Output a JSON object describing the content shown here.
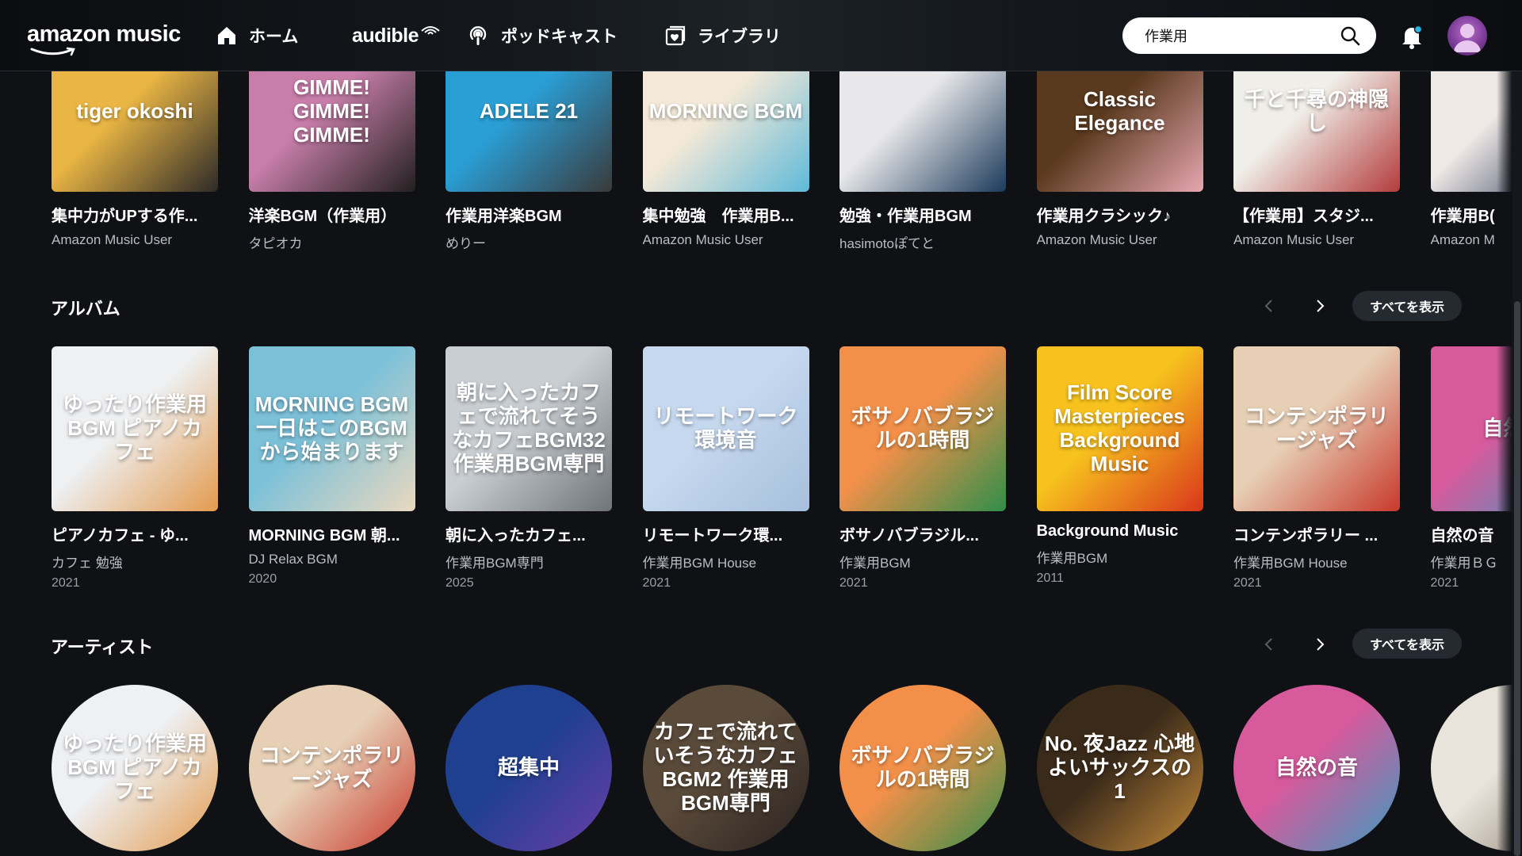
{
  "header": {
    "logo": "amazon music",
    "nav": [
      {
        "label": "ホーム",
        "icon": "home-icon"
      },
      {
        "label": "audible",
        "icon": "audible-icon"
      },
      {
        "label": "ポッドキャスト",
        "icon": "podcast-icon"
      },
      {
        "label": "ライブラリ",
        "icon": "library-icon"
      }
    ],
    "search": {
      "value": "作業用",
      "placeholder": ""
    }
  },
  "playlists": [
    {
      "title": "集中力がUPする作...",
      "sub": "Amazon Music User",
      "colors": [
        "#e9b544",
        "#2d2a28"
      ],
      "art_text": "tiger okoshi"
    },
    {
      "title": "洋楽BGM（作業用）",
      "sub": "タピオカ",
      "colors": [
        "#c77ea9",
        "#232020"
      ],
      "art_text": "GIMME! GIMME! GIMME!"
    },
    {
      "title": "作業用洋楽BGM",
      "sub": "めりー",
      "colors": [
        "#2a9fd6",
        "#3a3a3a"
      ],
      "art_text": "ADELE 21"
    },
    {
      "title": "集中勉強　作業用B...",
      "sub": "Amazon Music User",
      "colors": [
        "#f4e9d8",
        "#5fb9d8"
      ],
      "art_text": "MORNING BGM"
    },
    {
      "title": "勉強・作業用BGM",
      "sub": "hasimotoぽてと",
      "colors": [
        "#e8e8ea",
        "#1b3a5a"
      ],
      "art_text": ""
    },
    {
      "title": "作業用クラシック♪",
      "sub": "Amazon Music User",
      "colors": [
        "#5a3a1e",
        "#e6a6b0"
      ],
      "art_text": "Classic Elegance"
    },
    {
      "title": "【作業用】スタジ...",
      "sub": "Amazon Music User",
      "colors": [
        "#f0eee8",
        "#b33c3c"
      ],
      "art_text": "千と千尋の神隠し"
    },
    {
      "title": "作業用B(",
      "sub": "Amazon M",
      "colors": [
        "#efe9e6",
        "#1a2a4a"
      ],
      "art_text": ""
    }
  ],
  "albums_section": {
    "title": "アルバム",
    "show_all": "すべてを表示"
  },
  "albums": [
    {
      "title": "ピアノカフェ - ゆ...",
      "artist": "カフェ 勉強",
      "year": "2021",
      "colors": [
        "#eef0f2",
        "#e39a4e"
      ],
      "art_text": "ゆったり作業用BGM ピアノカフェ"
    },
    {
      "title": "MORNING BGM 朝...",
      "artist": "DJ Relax BGM",
      "year": "2020",
      "colors": [
        "#7cc0d8",
        "#e9d9bf"
      ],
      "art_text": "MORNING BGM 一日はこのBGMから始まります"
    },
    {
      "title": "朝に入ったカフェ...",
      "artist": "作業用BGM専門",
      "year": "2025",
      "colors": [
        "#c9ced2",
        "#6f7479"
      ],
      "art_text": "朝に入ったカフェで流れてそうなカフェBGM32 作業用BGM専門"
    },
    {
      "title": "リモートワーク環...",
      "artist": "作業用BGM House",
      "year": "2021",
      "colors": [
        "#c5d8ee",
        "#a6bfdc"
      ],
      "art_text": "リモートワーク環境音"
    },
    {
      "title": "ボサノバブラジル...",
      "artist": "作業用BGM",
      "year": "2021",
      "colors": [
        "#f2904a",
        "#2f8f4a"
      ],
      "art_text": "ボサノバブラジルの1時間"
    },
    {
      "title": "Background Music",
      "artist": "作業用BGM",
      "year": "2011",
      "colors": [
        "#f7c21e",
        "#d9361c"
      ],
      "art_text": "Film Score Masterpieces Background Music"
    },
    {
      "title": "コンテンポラリー ...",
      "artist": "作業用BGM House",
      "year": "2021",
      "colors": [
        "#e7cfb5",
        "#c8392b"
      ],
      "art_text": "コンテンポラリージャズ"
    },
    {
      "title": "自然の音",
      "artist": "作業用ＢＧ",
      "year": "2021",
      "colors": [
        "#d65a9c",
        "#3a9cc0"
      ],
      "art_text": "自然の"
    }
  ],
  "artists_section": {
    "title": "アーティスト",
    "show_all": "すべてを表示"
  },
  "artists": [
    {
      "colors": [
        "#eef0f2",
        "#e39a4e"
      ],
      "art_text": "ゆったり作業用BGM ピアノカフェ"
    },
    {
      "colors": [
        "#e7cfb5",
        "#c8392b"
      ],
      "art_text": "コンテンポラリージャズ"
    },
    {
      "colors": [
        "#1f3f8f",
        "#6a3fa8"
      ],
      "art_text": "超集中"
    },
    {
      "colors": [
        "#5a4a3a",
        "#2a2320"
      ],
      "art_text": "カフェで流れていそうなカフェBGM2 作業用BGM専門"
    },
    {
      "colors": [
        "#f2904a",
        "#2f8f4a"
      ],
      "art_text": "ボサノバブラジルの1時間"
    },
    {
      "colors": [
        "#3a2a1a",
        "#c48a3a"
      ],
      "art_text": "No. 夜Jazz 心地よいサックスの1"
    },
    {
      "colors": [
        "#d65a9c",
        "#3a9cc0"
      ],
      "art_text": "自然の音"
    },
    {
      "colors": [
        "#e8e4dc",
        "#8a7a6a"
      ],
      "art_text": ""
    }
  ],
  "theme": {
    "bg": "#0f1115",
    "card_text": "#ffffff",
    "muted": "#b9bec4",
    "pill": "#252a30"
  }
}
